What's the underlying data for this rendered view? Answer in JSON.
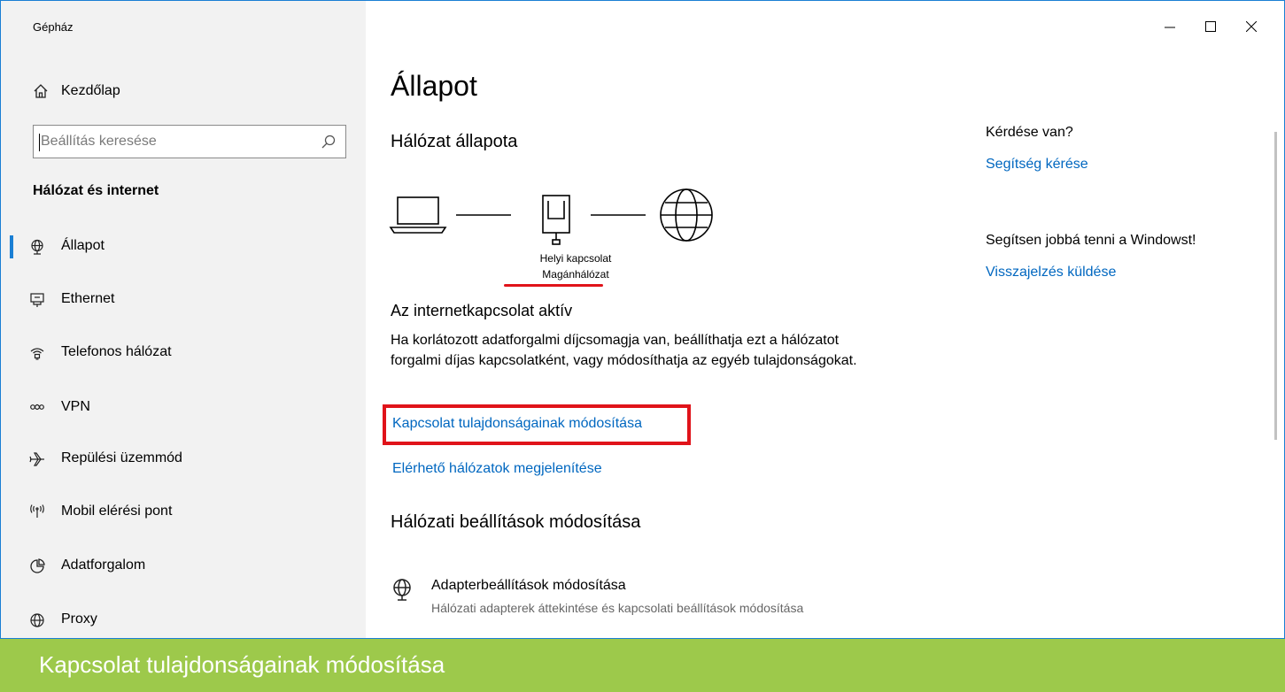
{
  "window": {
    "title": "Gépház"
  },
  "sidebar": {
    "home_label": "Kezdőlap",
    "search_placeholder": "Beállítás keresése",
    "section": "Hálózat és internet",
    "items": [
      {
        "label": "Állapot",
        "icon": "globe-network-icon",
        "selected": true
      },
      {
        "label": "Ethernet",
        "icon": "ethernet-icon",
        "selected": false
      },
      {
        "label": "Telefonos hálózat",
        "icon": "dialup-icon",
        "selected": false
      },
      {
        "label": "VPN",
        "icon": "vpn-icon",
        "selected": false
      },
      {
        "label": "Repülési üzemmód",
        "icon": "airplane-icon",
        "selected": false
      },
      {
        "label": "Mobil elérési pont",
        "icon": "hotspot-icon",
        "selected": false
      },
      {
        "label": "Adatforgalom",
        "icon": "data-usage-icon",
        "selected": false
      },
      {
        "label": "Proxy",
        "icon": "proxy-globe-icon",
        "selected": false
      }
    ]
  },
  "main": {
    "title": "Állapot",
    "network_status_heading": "Hálózat állapota",
    "connection_name": "Helyi kapcsolat",
    "connection_type": "Magánhálózat",
    "status_title": "Az internetkapcsolat aktív",
    "status_desc": "Ha korlátozott adatforgalmi díjcsomagja van, beállíthatja ezt a hálózatot forgalmi díjas kapcsolatként, vagy módosíthatja az egyéb tulajdonságokat.",
    "link_change_properties": "Kapcsolat tulajdonságainak módosítása",
    "link_show_networks": "Elérhető hálózatok megjelenítése",
    "change_settings_heading": "Hálózati beállítások módosítása",
    "adapter_title": "Adapterbeállítások módosítása",
    "adapter_subtitle": "Hálózati adapterek áttekintése és kapcsolati beállítások módosítása"
  },
  "help": {
    "question": "Kérdése van?",
    "help_link": "Segítség kérése",
    "improve": "Segítsen jobbá tenni a Windowst!",
    "feedback_link": "Visszajelzés küldése"
  },
  "caption": "Kapcsolat tulajdonságainak módosítása",
  "colors": {
    "accent": "#1a7fd4",
    "link": "#0067c0",
    "highlight": "#e0131a",
    "caption_bg": "#9dc94b",
    "sidebar_bg": "#f2f2f2"
  }
}
